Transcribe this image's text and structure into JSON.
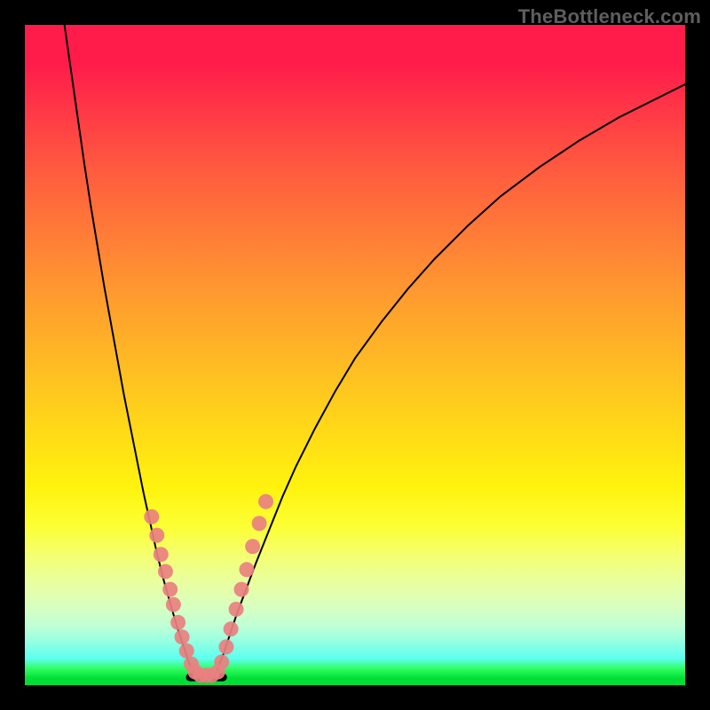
{
  "watermark": "TheBottleneck.com",
  "chart_data": {
    "type": "line",
    "title": "",
    "xlabel": "",
    "ylabel": "",
    "xlim": [
      0,
      1
    ],
    "ylim": [
      0,
      1
    ],
    "x_optimum": 0.265,
    "series": [
      {
        "name": "left-curve",
        "x": [
          0.06,
          0.07,
          0.08,
          0.09,
          0.1,
          0.11,
          0.12,
          0.13,
          0.14,
          0.15,
          0.16,
          0.17,
          0.18,
          0.19,
          0.2,
          0.21,
          0.22,
          0.23,
          0.24,
          0.25,
          0.26
        ],
        "y": [
          1.0,
          0.93,
          0.86,
          0.79,
          0.725,
          0.665,
          0.605,
          0.55,
          0.495,
          0.44,
          0.39,
          0.34,
          0.29,
          0.245,
          0.2,
          0.16,
          0.125,
          0.09,
          0.06,
          0.03,
          0.015
        ]
      },
      {
        "name": "right-curve",
        "x": [
          0.29,
          0.3,
          0.31,
          0.32,
          0.335,
          0.35,
          0.37,
          0.39,
          0.41,
          0.44,
          0.47,
          0.5,
          0.54,
          0.58,
          0.62,
          0.67,
          0.72,
          0.78,
          0.84,
          0.9,
          0.96,
          1.0
        ],
        "y": [
          0.02,
          0.045,
          0.075,
          0.105,
          0.145,
          0.185,
          0.235,
          0.285,
          0.33,
          0.39,
          0.445,
          0.495,
          0.55,
          0.6,
          0.645,
          0.695,
          0.74,
          0.785,
          0.825,
          0.86,
          0.89,
          0.91
        ]
      },
      {
        "name": "flat-bottom",
        "x": [
          0.25,
          0.3
        ],
        "y": [
          0.012,
          0.012
        ]
      }
    ],
    "markers": {
      "name": "highlight-dots",
      "color": "#e98080",
      "points": [
        {
          "x": 0.192,
          "y": 0.255
        },
        {
          "x": 0.2,
          "y": 0.227
        },
        {
          "x": 0.206,
          "y": 0.198
        },
        {
          "x": 0.213,
          "y": 0.172
        },
        {
          "x": 0.22,
          "y": 0.145
        },
        {
          "x": 0.225,
          "y": 0.122
        },
        {
          "x": 0.232,
          "y": 0.095
        },
        {
          "x": 0.238,
          "y": 0.073
        },
        {
          "x": 0.245,
          "y": 0.052
        },
        {
          "x": 0.252,
          "y": 0.032
        },
        {
          "x": 0.258,
          "y": 0.02
        },
        {
          "x": 0.266,
          "y": 0.015
        },
        {
          "x": 0.275,
          "y": 0.015
        },
        {
          "x": 0.283,
          "y": 0.015
        },
        {
          "x": 0.292,
          "y": 0.02
        },
        {
          "x": 0.298,
          "y": 0.035
        },
        {
          "x": 0.305,
          "y": 0.058
        },
        {
          "x": 0.312,
          "y": 0.085
        },
        {
          "x": 0.32,
          "y": 0.115
        },
        {
          "x": 0.328,
          "y": 0.145
        },
        {
          "x": 0.336,
          "y": 0.175
        },
        {
          "x": 0.345,
          "y": 0.21
        },
        {
          "x": 0.355,
          "y": 0.245
        },
        {
          "x": 0.365,
          "y": 0.278
        }
      ]
    }
  }
}
